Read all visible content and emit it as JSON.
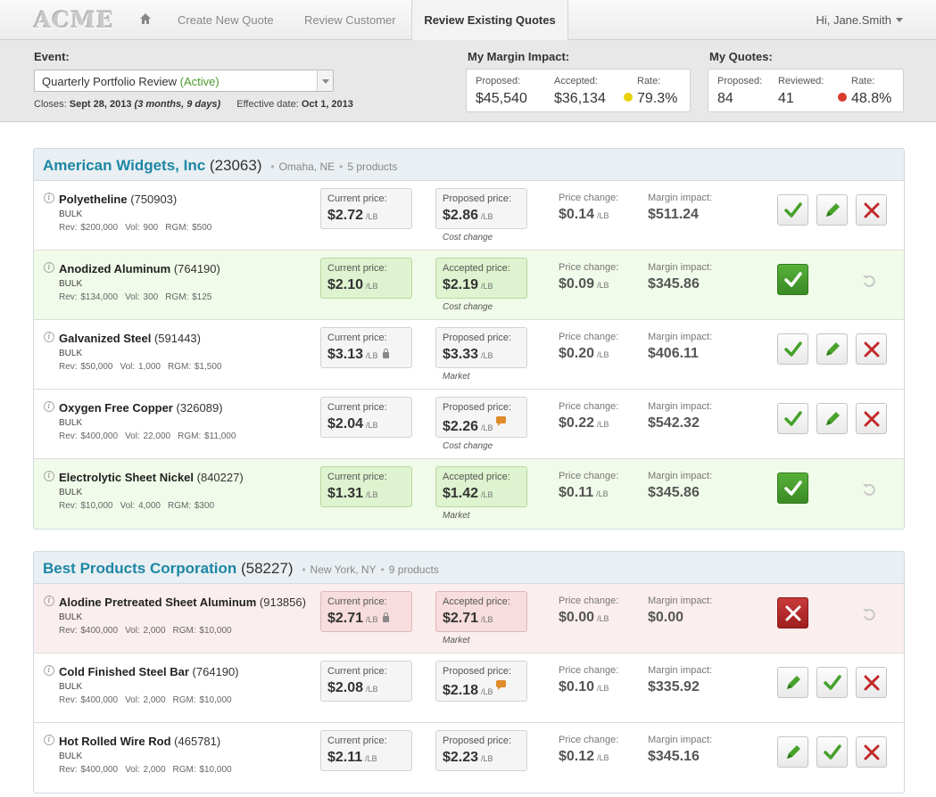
{
  "nav": {
    "logo": "ACME",
    "links": [
      "Create New Quote",
      "Review Customer"
    ],
    "active_tab": "Review Existing Quotes",
    "user": "Hi, Jane.Smith"
  },
  "event": {
    "label": "Event:",
    "selected": "Quarterly Portfolio Review",
    "status": "(Active)",
    "closes_label": "Closes:",
    "closes_date": "Sept 28, 2013",
    "closes_duration": "(3 months, 9 days)",
    "effective_label": "Effective date:",
    "effective_date": "Oct 1, 2013"
  },
  "margin_impact": {
    "title": "My Margin Impact:",
    "proposed_label": "Proposed:",
    "proposed": "$45,540",
    "accepted_label": "Accepted:",
    "accepted": "$36,134",
    "rate_label": "Rate:",
    "rate": "79.3%",
    "rate_color": "#e8d20c"
  },
  "my_quotes": {
    "title": "My Quotes:",
    "proposed_label": "Proposed:",
    "proposed": "84",
    "reviewed_label": "Reviewed:",
    "reviewed": "41",
    "rate_label": "Rate:",
    "rate": "48.8%",
    "rate_color": "#d93a2b"
  },
  "groups": [
    {
      "name": "American Widgets, Inc",
      "id": "(23063)",
      "location": "Omaha, NE",
      "count": "5 products",
      "rows": [
        {
          "name": "Polyetheline",
          "id": "(750903)",
          "kind": "BULK",
          "rev": "Rev: $200,000",
          "vol": "Vol: 900",
          "rgm": "RGM: $500",
          "current_label": "Current price:",
          "current": "$2.72",
          "unit": "/LB",
          "proposed_label": "Proposed price:",
          "proposed": "$2.86",
          "note": "Cost change",
          "change_label": "Price change:",
          "change": "$0.14",
          "impact_label": "Margin impact:",
          "impact": "$511.24"
        },
        {
          "name": "Anodized Aluminum",
          "id": "(764190)",
          "kind": "BULK",
          "rev": "Rev: $134,000",
          "vol": "Vol: 300",
          "rgm": "RGM: $125",
          "current_label": "Current price:",
          "current": "$2.10",
          "unit": "/LB",
          "proposed_label": "Accepted price:",
          "proposed": "$2.19",
          "note": "Cost change",
          "change_label": "Price change:",
          "change": "$0.09",
          "impact_label": "Margin impact:",
          "impact": "$345.86"
        },
        {
          "name": "Galvanized Steel",
          "id": "(591443)",
          "kind": "BULK",
          "rev": "Rev: $50,000",
          "vol": "Vol: 1,000",
          "rgm": "RGM: $1,500",
          "current_label": "Current price:",
          "current": "$3.13",
          "unit": "/LB",
          "proposed_label": "Proposed price:",
          "proposed": "$3.33",
          "note": "Market",
          "change_label": "Price change:",
          "change": "$0.20",
          "impact_label": "Margin impact:",
          "impact": "$406.11"
        },
        {
          "name": "Oxygen Free Copper",
          "id": "(326089)",
          "kind": "BULK",
          "rev": "Rev: $400,000",
          "vol": "Vol: 22,000",
          "rgm": "RGM: $11,000",
          "current_label": "Current price:",
          "current": "$2.04",
          "unit": "/LB",
          "proposed_label": "Proposed price:",
          "proposed": "$2.26",
          "note": "Cost change",
          "change_label": "Price change:",
          "change": "$0.22",
          "impact_label": "Margin impact:",
          "impact": "$542.32"
        },
        {
          "name": "Electrolytic Sheet Nickel",
          "id": "(840227)",
          "kind": "BULK",
          "rev": "Rev: $10,000",
          "vol": "Vol: 4,000",
          "rgm": "RGM: $300",
          "current_label": "Current price:",
          "current": "$1.31",
          "unit": "/LB",
          "proposed_label": "Accepted price:",
          "proposed": "$1.42",
          "note": "Market",
          "change_label": "Price change:",
          "change": "$0.11",
          "impact_label": "Margin impact:",
          "impact": "$345.86"
        }
      ]
    },
    {
      "name": "Best Products Corporation",
      "id": "(58227)",
      "location": "New York, NY",
      "count": "9 products",
      "rows": [
        {
          "name": "Alodine Pretreated Sheet Aluminum",
          "id": "(913856)",
          "kind": "BULK",
          "rev": "Rev: $400,000",
          "vol": "Vol: 2,000",
          "rgm": "RGM: $10,000",
          "current_label": "Current price:",
          "current": "$2.71",
          "unit": "/LB",
          "proposed_label": "Accepted price:",
          "proposed": "$2.71",
          "note": "Market",
          "change_label": "Price change:",
          "change": "$0.00",
          "impact_label": "Margin impact:",
          "impact": "$0.00"
        },
        {
          "name": "Cold Finished Steel Bar",
          "id": "(764190)",
          "kind": "BULK",
          "rev": "Rev: $400,000",
          "vol": "Vol: 2,000",
          "rgm": "RGM: $10,000",
          "current_label": "Current price:",
          "current": "$2.08",
          "unit": "/LB",
          "proposed_label": "Proposed price:",
          "proposed": "$2.18",
          "note": "",
          "change_label": "Price change:",
          "change": "$0.10",
          "impact_label": "Margin impact:",
          "impact": "$335.92"
        },
        {
          "name": "Hot Rolled Wire Rod",
          "id": "(465781)",
          "kind": "BULK",
          "rev": "Rev: $400,000",
          "vol": "Vol: 2,000",
          "rgm": "RGM: $10,000",
          "current_label": "Current price:",
          "current": "$2.11",
          "unit": "/LB",
          "proposed_label": "Proposed price:",
          "proposed": "$2.23",
          "note": "",
          "change_label": "Price change:",
          "change": "$0.12",
          "impact_label": "Margin impact:",
          "impact": "$345.16"
        }
      ]
    }
  ]
}
